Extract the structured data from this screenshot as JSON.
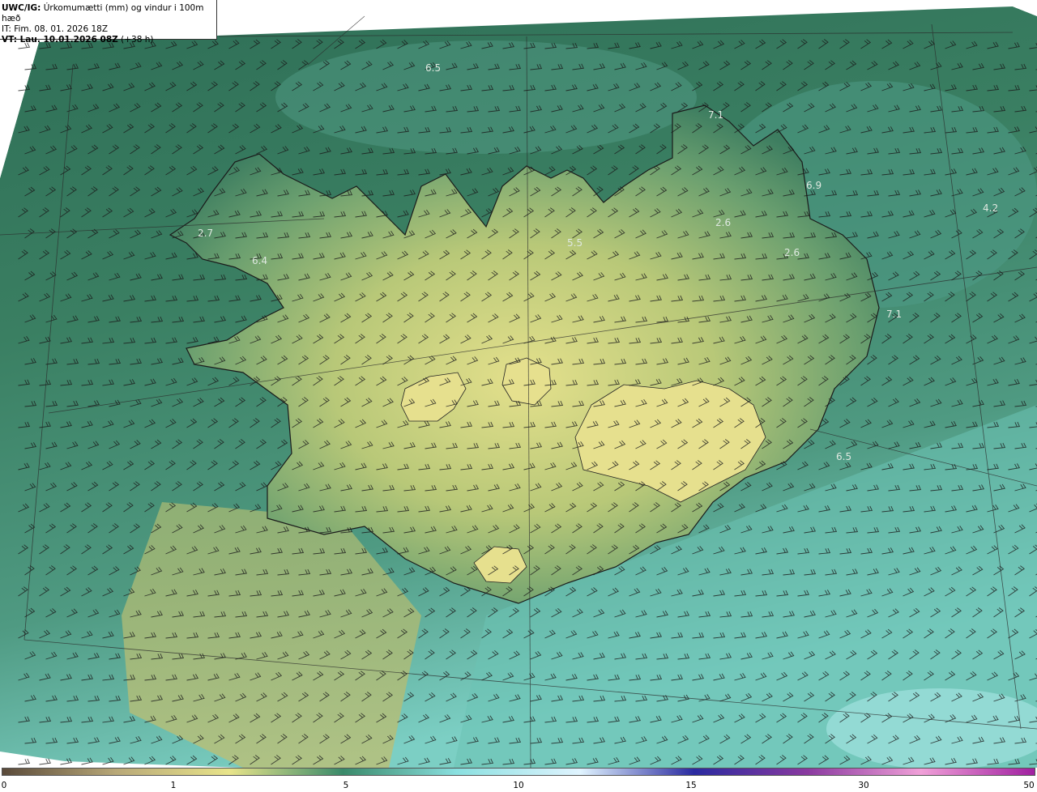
{
  "header": {
    "model": "UWC/IG:",
    "title": "Úrkomumætti (mm) og vindur i 100m hæð",
    "initial_time": "IT: Fim. 08. 01. 2026 18Z",
    "valid_prefix": "VT: Lau. 10.01.2026 08Z",
    "valid_suffix": "(+38 h)"
  },
  "map_labels": [
    "6.5",
    "7.1",
    "6.9",
    "4.2",
    "2.6",
    "2.7",
    "5.5",
    "6.4",
    "2.6",
    "7.1",
    "6.5"
  ],
  "colorbar": {
    "ticks": [
      "0",
      "1",
      "5",
      "10",
      "15",
      "30",
      "50"
    ],
    "colors": [
      "#5a4a3a",
      "#b8a878",
      "#e8e48a",
      "#3a8a6a",
      "#8ae0e0",
      "#e0f4ff",
      "#2a2aa0",
      "#8a3aa0",
      "#f0a0d8",
      "#a020a0"
    ]
  },
  "colors": {
    "ocean_dark": "#2f6f55",
    "ocean_teal": "#5ab0a0",
    "land_yellow": "#d8d880",
    "label": "#dfe8e0"
  }
}
